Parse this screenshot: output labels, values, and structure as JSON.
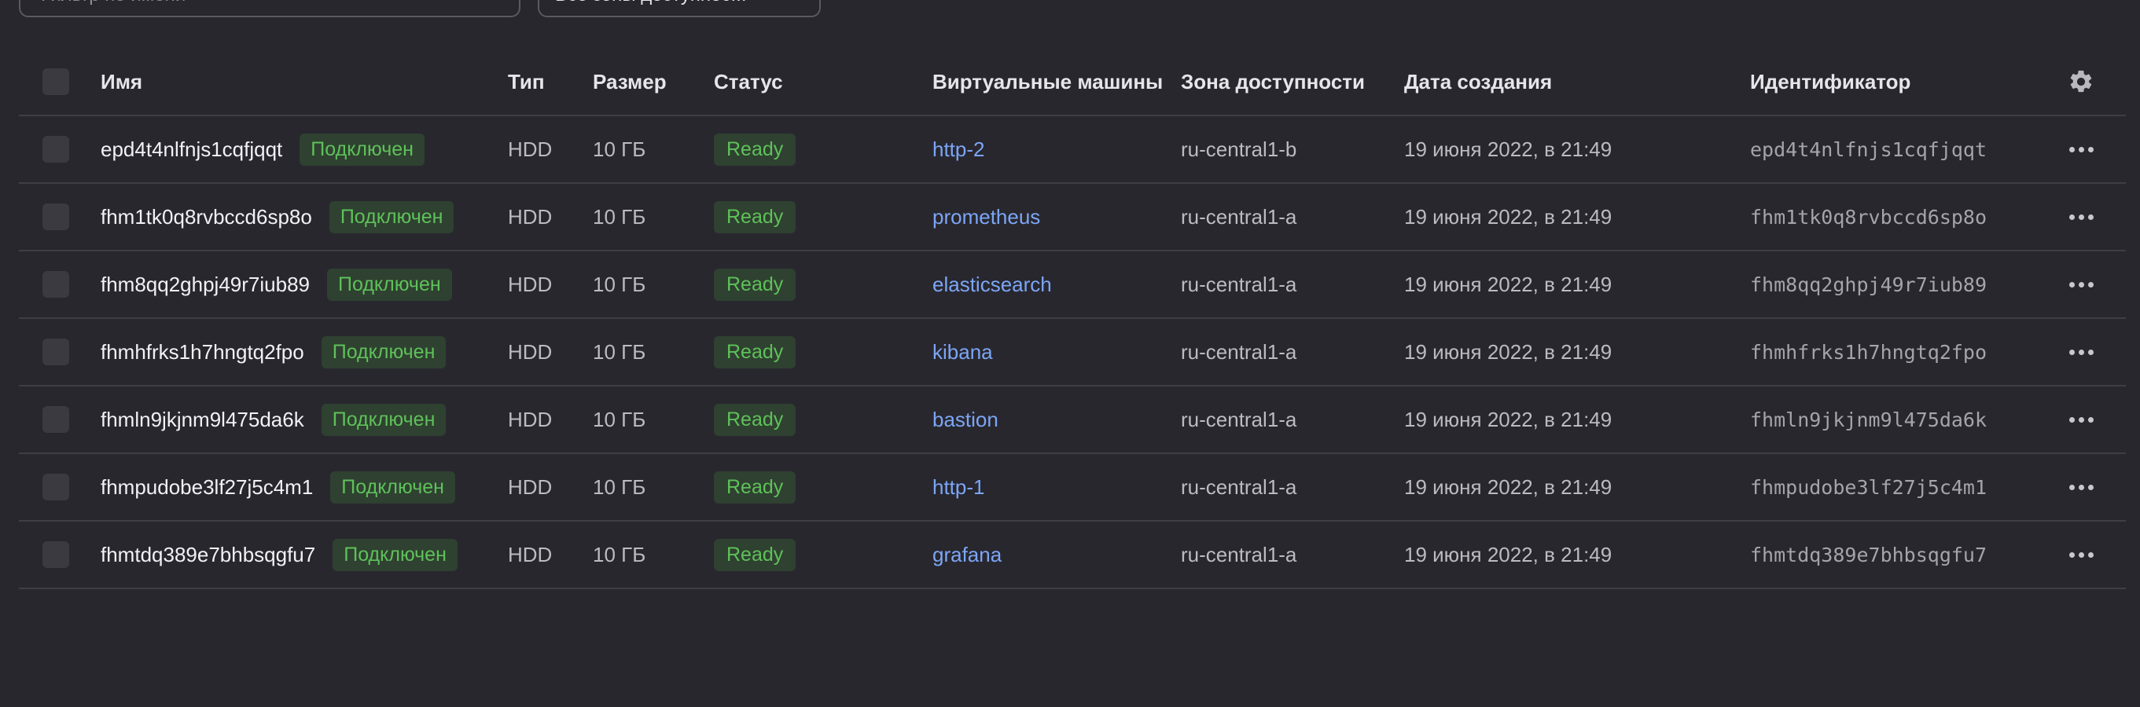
{
  "filter": {
    "placeholder": "Фильтр по имени"
  },
  "zone_select": {
    "value": "Все зоны доступнос..."
  },
  "table": {
    "headers": {
      "name": "Имя",
      "type": "Тип",
      "size": "Размер",
      "status": "Статус",
      "vms": "Виртуальные машины",
      "zone": "Зона доступности",
      "created": "Дата создания",
      "id": "Идентификатор"
    },
    "rows": [
      {
        "name": "epd4t4nlfnjs1cqfjqqt",
        "badge": "Подключен",
        "type": "HDD",
        "size": "10 ГБ",
        "status": "Ready",
        "vm": "http-2",
        "zone": "ru-central1-b",
        "created": "19 июня 2022, в 21:49",
        "id": "epd4t4nlfnjs1cqfjqqt"
      },
      {
        "name": "fhm1tk0q8rvbccd6sp8o",
        "badge": "Подключен",
        "type": "HDD",
        "size": "10 ГБ",
        "status": "Ready",
        "vm": "prometheus",
        "zone": "ru-central1-a",
        "created": "19 июня 2022, в 21:49",
        "id": "fhm1tk0q8rvbccd6sp8o"
      },
      {
        "name": "fhm8qq2ghpj49r7iub89",
        "badge": "Подключен",
        "type": "HDD",
        "size": "10 ГБ",
        "status": "Ready",
        "vm": "elasticsearch",
        "zone": "ru-central1-a",
        "created": "19 июня 2022, в 21:49",
        "id": "fhm8qq2ghpj49r7iub89"
      },
      {
        "name": "fhmhfrks1h7hngtq2fpo",
        "badge": "Подключен",
        "type": "HDD",
        "size": "10 ГБ",
        "status": "Ready",
        "vm": "kibana",
        "zone": "ru-central1-a",
        "created": "19 июня 2022, в 21:49",
        "id": "fhmhfrks1h7hngtq2fpo"
      },
      {
        "name": "fhmln9jkjnm9l475da6k",
        "badge": "Подключен",
        "type": "HDD",
        "size": "10 ГБ",
        "status": "Ready",
        "vm": "bastion",
        "zone": "ru-central1-a",
        "created": "19 июня 2022, в 21:49",
        "id": "fhmln9jkjnm9l475da6k"
      },
      {
        "name": "fhmpudobe3lf27j5c4m1",
        "badge": "Подключен",
        "type": "HDD",
        "size": "10 ГБ",
        "status": "Ready",
        "vm": "http-1",
        "zone": "ru-central1-a",
        "created": "19 июня 2022, в 21:49",
        "id": "fhmpudobe3lf27j5c4m1"
      },
      {
        "name": "fhmtdq389e7bhbsqgfu7",
        "badge": "Подключен",
        "type": "HDD",
        "size": "10 ГБ",
        "status": "Ready",
        "vm": "grafana",
        "zone": "ru-central1-a",
        "created": "19 июня 2022, в 21:49",
        "id": "fhmtdq389e7bhbsqgfu7"
      }
    ]
  },
  "icons": {
    "settings": "gear-icon",
    "row_actions": "more-horizontal-icon",
    "select_chevron": "chevron-down-icon"
  },
  "colors": {
    "background": "#28272e",
    "status_green": "#5ec15a",
    "link_blue": "#7ca6f5"
  }
}
